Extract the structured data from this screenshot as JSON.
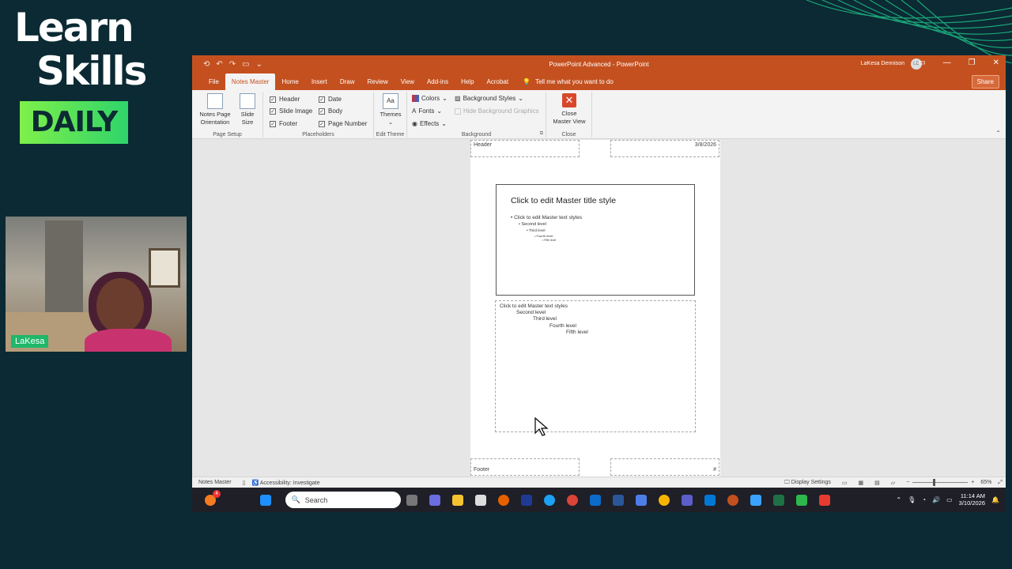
{
  "brand": {
    "line1": "Learn",
    "line2": "Skills",
    "line3": "DAILY"
  },
  "webcam": {
    "name": "LaKesa"
  },
  "window": {
    "title": "PowerPoint Advanced  -  PowerPoint",
    "user": "LaKesa Dennison",
    "user_initials": "LD",
    "share_label": "Share"
  },
  "tabs": [
    "File",
    "Notes Master",
    "Home",
    "Insert",
    "Draw",
    "Review",
    "View",
    "Add-ins",
    "Help",
    "Acrobat"
  ],
  "tell_me": "Tell me what you want to do",
  "ribbon": {
    "page_setup": {
      "orientation": "Notes Page Orientation",
      "orientation_l1": "Notes Page",
      "orientation_l2": "Orientation",
      "slide_size_l1": "Slide",
      "slide_size_l2": "Size",
      "label": "Page Setup"
    },
    "placeholders": {
      "header": "Header",
      "slide_image": "Slide Image",
      "footer": "Footer",
      "date": "Date",
      "body": "Body",
      "page_number": "Page Number",
      "label": "Placeholders"
    },
    "edit_theme": {
      "themes": "Themes",
      "label": "Edit Theme"
    },
    "background": {
      "colors": "Colors",
      "fonts": "Fonts",
      "effects": "Effects",
      "background_styles": "Background Styles",
      "hide_bg": "Hide Background Graphics",
      "label": "Background"
    },
    "close": {
      "l1": "Close",
      "l2": "Master View",
      "label": "Close"
    }
  },
  "notes_page": {
    "header": "Header",
    "date": "3/8/2026",
    "footer": "Footer",
    "page_number": "#",
    "slide_title": "Click to edit Master title style",
    "slide_levels": [
      "Click to edit Master text styles",
      "Second level",
      "Third level",
      "Fourth level",
      "Fifth level"
    ],
    "notes_levels": [
      "Click to edit Master text styles",
      "Second level",
      "Third level",
      "Fourth level",
      "Fifth level"
    ]
  },
  "status": {
    "view": "Notes Master",
    "accessibility": "Accessibility: Investigate",
    "display_settings": "Display Settings",
    "zoom": "65%"
  },
  "taskbar": {
    "search": "Search",
    "time": "11:14 AM",
    "date": "3/10/2026",
    "notif_count": "4"
  }
}
